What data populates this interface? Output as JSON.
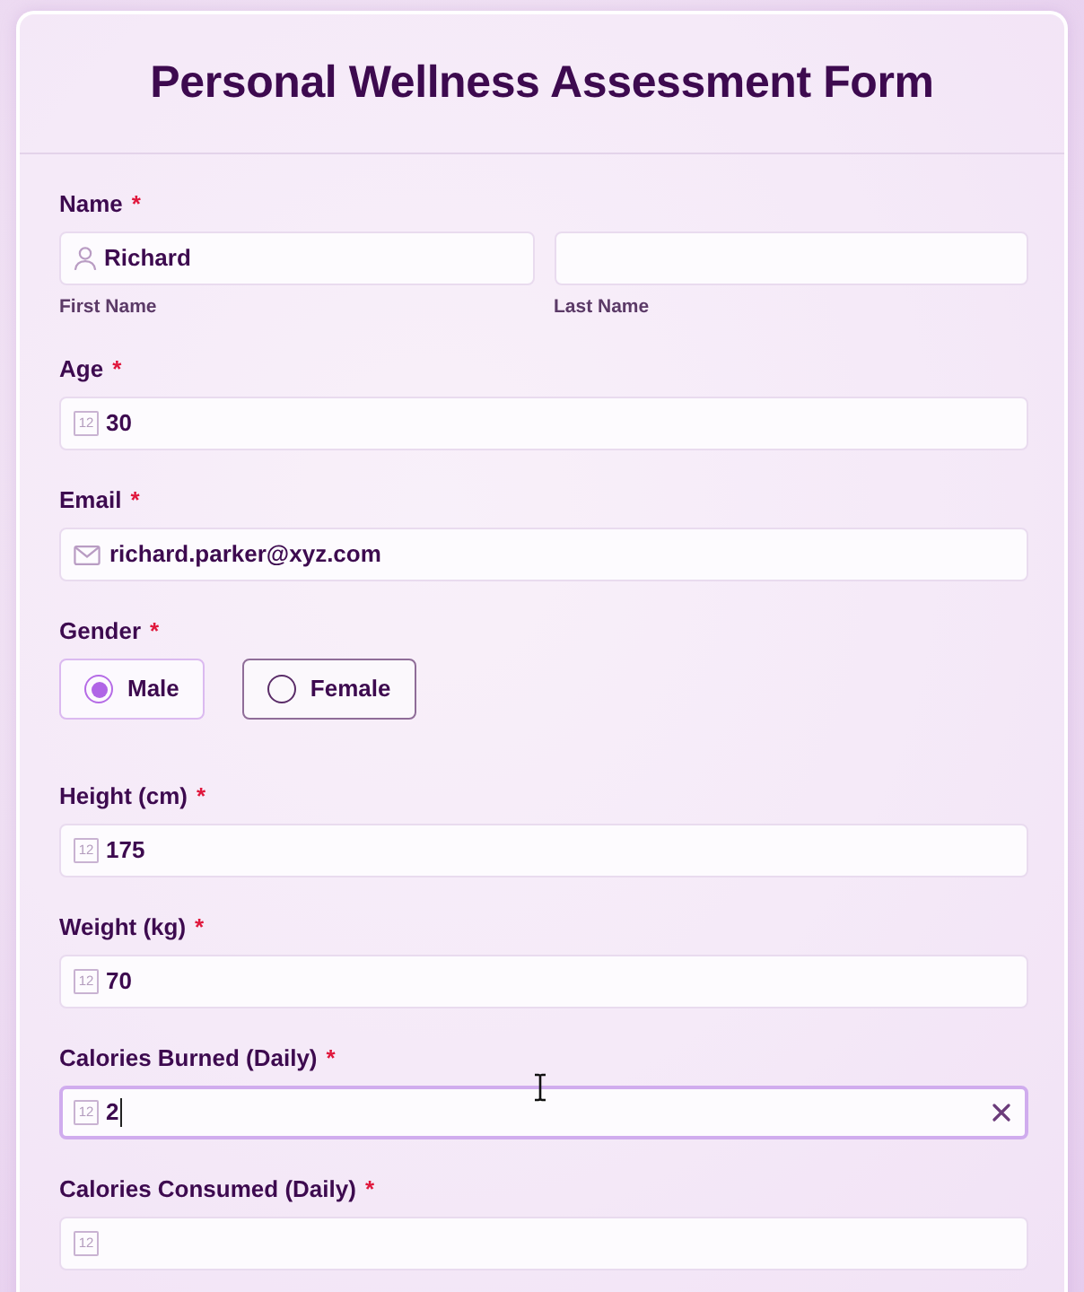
{
  "form": {
    "title": "Personal Wellness Assessment Form"
  },
  "fields": [
    {
      "kind": "name",
      "label": "Name",
      "required_mark": "*",
      "parts": [
        {
          "value": "Richard",
          "sublabel": "First Name"
        },
        {
          "sublabel": "Last Name"
        }
      ]
    },
    {
      "kind": "number",
      "label": "Age",
      "required_mark": "*",
      "icon_label": "12",
      "value": "30",
      "focused": false
    },
    {
      "kind": "email",
      "label": "Email",
      "required_mark": "*",
      "value": "richard.parker@xyz.com",
      "focused": false
    },
    {
      "kind": "choice",
      "label": "Gender",
      "required_mark": "*",
      "options": [
        {
          "label": "Male",
          "selected": true
        },
        {
          "label": "Female",
          "selected": false
        }
      ]
    },
    {
      "kind": "number",
      "label": "Height (cm)",
      "required_mark": "*",
      "icon_label": "12",
      "value": "175",
      "focused": false
    },
    {
      "kind": "number",
      "label": "Weight (kg)",
      "required_mark": "*",
      "icon_label": "12",
      "value": "70",
      "focused": false
    },
    {
      "kind": "number",
      "label": "Calories Burned (Daily)",
      "required_mark": "*",
      "icon_label": "12",
      "value": "2",
      "focused": true
    },
    {
      "kind": "number",
      "label": "Calories Consumed (Daily)",
      "required_mark": "*",
      "icon_label": "12",
      "focused": false
    }
  ]
}
